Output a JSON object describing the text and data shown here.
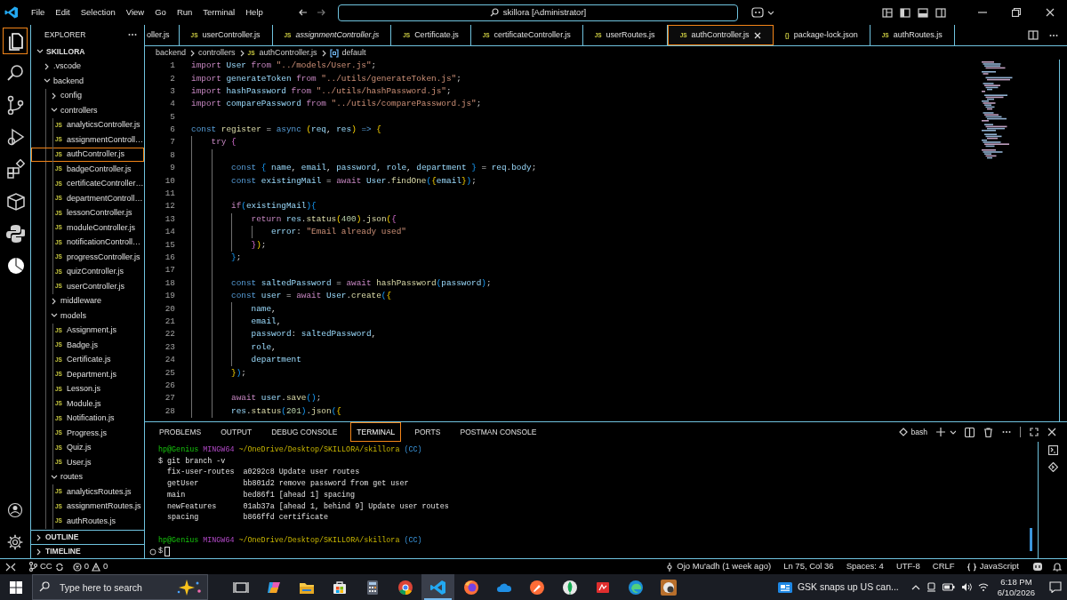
{
  "title_bar": {
    "menu": [
      "File",
      "Edit",
      "Selection",
      "View",
      "Go",
      "Run",
      "Terminal",
      "Help"
    ],
    "command_center": "skillora [Administrator]"
  },
  "activity_bar": {
    "items": [
      {
        "kind": "explorer",
        "selected": true
      },
      {
        "kind": "search",
        "selected": false
      },
      {
        "kind": "source-control",
        "selected": false
      },
      {
        "kind": "run-debug",
        "selected": false
      },
      {
        "kind": "extensions",
        "selected": false
      },
      {
        "kind": "box",
        "selected": false
      },
      {
        "kind": "python",
        "selected": false
      },
      {
        "kind": "chart",
        "selected": false
      }
    ],
    "bottom": [
      {
        "kind": "account"
      },
      {
        "kind": "settings"
      }
    ]
  },
  "sidebar": {
    "title": "EXPLORER",
    "tree": {
      "label": "SKILLORA",
      "kind": "folder",
      "expanded": true,
      "selected": false,
      "children": [
        {
          "label": ".vscode",
          "kind": "folder",
          "expanded": false,
          "selected": false
        },
        {
          "label": "backend",
          "kind": "folder",
          "expanded": true,
          "selected": false,
          "children": [
            {
              "label": "config",
              "kind": "folder",
              "expanded": false,
              "selected": false
            },
            {
              "label": "controllers",
              "kind": "folder",
              "expanded": true,
              "selected": false,
              "children": [
                {
                  "label": "analyticsController.js",
                  "kind": "file",
                  "badge": "JS",
                  "selected": false
                },
                {
                  "label": "assignmentControll…",
                  "kind": "file",
                  "badge": "JS",
                  "selected": false
                },
                {
                  "label": "authController.js",
                  "kind": "file",
                  "badge": "JS",
                  "selected": true
                },
                {
                  "label": "badgeController.js",
                  "kind": "file",
                  "badge": "JS",
                  "selected": false
                },
                {
                  "label": "certificateController…",
                  "kind": "file",
                  "badge": "JS",
                  "selected": false
                },
                {
                  "label": "departmentControll…",
                  "kind": "file",
                  "badge": "JS",
                  "selected": false
                },
                {
                  "label": "lessonController.js",
                  "kind": "file",
                  "badge": "JS",
                  "selected": false
                },
                {
                  "label": "moduleController.js",
                  "kind": "file",
                  "badge": "JS",
                  "selected": false
                },
                {
                  "label": "notificationControll…",
                  "kind": "file",
                  "badge": "JS",
                  "selected": false
                },
                {
                  "label": "progressController.js",
                  "kind": "file",
                  "badge": "JS",
                  "selected": false
                },
                {
                  "label": "quizController.js",
                  "kind": "file",
                  "badge": "JS",
                  "selected": false
                },
                {
                  "label": "userController.js",
                  "kind": "file",
                  "badge": "JS",
                  "selected": false
                }
              ]
            },
            {
              "label": "middleware",
              "kind": "folder",
              "expanded": false,
              "selected": false
            },
            {
              "label": "models",
              "kind": "folder",
              "expanded": true,
              "selected": false,
              "children": [
                {
                  "label": "Assignment.js",
                  "kind": "file",
                  "badge": "JS",
                  "selected": false
                },
                {
                  "label": "Badge.js",
                  "kind": "file",
                  "badge": "JS",
                  "selected": false
                },
                {
                  "label": "Certificate.js",
                  "kind": "file",
                  "badge": "JS",
                  "selected": false
                },
                {
                  "label": "Department.js",
                  "kind": "file",
                  "badge": "JS",
                  "selected": false
                },
                {
                  "label": "Lesson.js",
                  "kind": "file",
                  "badge": "JS",
                  "selected": false
                },
                {
                  "label": "Module.js",
                  "kind": "file",
                  "badge": "JS",
                  "selected": false
                },
                {
                  "label": "Notification.js",
                  "kind": "file",
                  "badge": "JS",
                  "selected": false
                },
                {
                  "label": "Progress.js",
                  "kind": "file",
                  "badge": "JS",
                  "selected": false
                },
                {
                  "label": "Quiz.js",
                  "kind": "file",
                  "badge": "JS",
                  "selected": false
                },
                {
                  "label": "User.js",
                  "kind": "file",
                  "badge": "JS",
                  "selected": false
                }
              ]
            },
            {
              "label": "routes",
              "kind": "folder",
              "expanded": true,
              "selected": false,
              "children": [
                {
                  "label": "analyticsRoutes.js",
                  "kind": "file",
                  "badge": "JS",
                  "selected": false
                },
                {
                  "label": "assignmentRoutes.js",
                  "kind": "file",
                  "badge": "JS",
                  "selected": false
                },
                {
                  "label": "authRoutes.js",
                  "kind": "file",
                  "badge": "JS",
                  "selected": false
                }
              ]
            }
          ]
        }
      ]
    },
    "sections": [
      {
        "label": "OUTLINE",
        "expanded": false
      },
      {
        "label": "TIMELINE",
        "expanded": false
      }
    ]
  },
  "editor": {
    "tabs": [
      {
        "label": "oller.js",
        "selected": false,
        "preview": false
      },
      {
        "label": "userController.js",
        "badge": "JS",
        "selected": false,
        "preview": false
      },
      {
        "label": "assignmentController.js",
        "badge": "JS",
        "selected": false,
        "preview": true
      },
      {
        "label": "Certificate.js",
        "badge": "JS",
        "selected": false,
        "preview": false
      },
      {
        "label": "certificateController.js",
        "badge": "JS",
        "selected": false,
        "preview": false
      },
      {
        "label": "userRoutes.js",
        "badge": "JS",
        "selected": false,
        "preview": false
      },
      {
        "label": "authController.js",
        "badge": "JS",
        "selected": true,
        "preview": false
      },
      {
        "label": "package-lock.json",
        "badge": "{}",
        "selected": false,
        "preview": false
      },
      {
        "label": "authRoutes.js",
        "badge": "JS",
        "selected": false,
        "preview": false
      }
    ],
    "breadcrumb": [
      {
        "label": "backend",
        "kind": "folder"
      },
      {
        "label": "controllers",
        "kind": "folder"
      },
      {
        "label": "authController.js",
        "kind": "file",
        "badge": "JS"
      },
      {
        "label": "default",
        "kind": "symbol"
      }
    ],
    "lines": [
      {
        "number": "1",
        "tokens": [
          {
            "kind": "kw",
            "text": "import "
          },
          {
            "kind": "var",
            "text": "User "
          },
          {
            "kind": "kw",
            "text": "from "
          },
          {
            "kind": "str",
            "text": "\"../models/User.js\""
          },
          {
            "kind": "p",
            "text": ";"
          }
        ]
      },
      {
        "number": "2",
        "tokens": [
          {
            "kind": "kw",
            "text": "import "
          },
          {
            "kind": "var",
            "text": "generateToken "
          },
          {
            "kind": "kw",
            "text": "from "
          },
          {
            "kind": "str",
            "text": "\"../utils/generateToken.js\""
          },
          {
            "kind": "p",
            "text": ";"
          }
        ]
      },
      {
        "number": "3",
        "tokens": [
          {
            "kind": "kw",
            "text": "import "
          },
          {
            "kind": "var",
            "text": "hashPassword "
          },
          {
            "kind": "kw",
            "text": "from "
          },
          {
            "kind": "str",
            "text": "\"../utils/hashPassword.js\""
          },
          {
            "kind": "p",
            "text": ";"
          }
        ]
      },
      {
        "number": "4",
        "tokens": [
          {
            "kind": "kw",
            "text": "import "
          },
          {
            "kind": "var",
            "text": "comparePassword "
          },
          {
            "kind": "kw",
            "text": "from "
          },
          {
            "kind": "str",
            "text": "\"../utils/comparePassword.js\""
          },
          {
            "kind": "p",
            "text": ";"
          }
        ]
      },
      {
        "number": "5"
      },
      {
        "number": "6",
        "tokens": [
          {
            "kind": "st",
            "text": "const "
          },
          {
            "kind": "fn",
            "text": "register"
          },
          {
            "kind": "p",
            "text": " = "
          },
          {
            "kind": "st",
            "text": "async "
          },
          {
            "kind": "b1",
            "text": "("
          },
          {
            "kind": "var",
            "text": "req"
          },
          {
            "kind": "p",
            "text": ", "
          },
          {
            "kind": "var",
            "text": "res"
          },
          {
            "kind": "b1",
            "text": ")"
          },
          {
            "kind": "st",
            "text": " => "
          },
          {
            "kind": "b1",
            "text": "{"
          }
        ]
      },
      {
        "number": "7",
        "tokens": [
          {
            "kind": "kw",
            "text": "    try "
          },
          {
            "kind": "b2",
            "text": "{"
          }
        ]
      },
      {
        "number": "8"
      },
      {
        "number": "9",
        "tokens": [
          {
            "kind": "st",
            "text": "        const "
          },
          {
            "kind": "b3",
            "text": "{ "
          },
          {
            "kind": "var",
            "text": "name"
          },
          {
            "kind": "p",
            "text": ", "
          },
          {
            "kind": "var",
            "text": "email"
          },
          {
            "kind": "p",
            "text": ", "
          },
          {
            "kind": "var",
            "text": "password"
          },
          {
            "kind": "p",
            "text": ", "
          },
          {
            "kind": "var",
            "text": "role"
          },
          {
            "kind": "p",
            "text": ", "
          },
          {
            "kind": "var",
            "text": "department"
          },
          {
            "kind": "b3",
            "text": " }"
          },
          {
            "kind": "p",
            "text": " = "
          },
          {
            "kind": "var",
            "text": "req"
          },
          {
            "kind": "p",
            "text": "."
          },
          {
            "kind": "var",
            "text": "body"
          },
          {
            "kind": "p",
            "text": ";"
          }
        ]
      },
      {
        "number": "10",
        "tokens": [
          {
            "kind": "st",
            "text": "        const "
          },
          {
            "kind": "var",
            "text": "existingMail"
          },
          {
            "kind": "p",
            "text": " = "
          },
          {
            "kind": "kw",
            "text": "await "
          },
          {
            "kind": "var",
            "text": "User"
          },
          {
            "kind": "p",
            "text": "."
          },
          {
            "kind": "fn",
            "text": "findOne"
          },
          {
            "kind": "b3",
            "text": "("
          },
          {
            "kind": "b1",
            "text": "{"
          },
          {
            "kind": "var",
            "text": "email"
          },
          {
            "kind": "b1",
            "text": "}"
          },
          {
            "kind": "b3",
            "text": ")"
          },
          {
            "kind": "p",
            "text": ";"
          }
        ]
      },
      {
        "number": "11"
      },
      {
        "number": "12",
        "tokens": [
          {
            "kind": "kw",
            "text": "        if"
          },
          {
            "kind": "b3",
            "text": "("
          },
          {
            "kind": "var",
            "text": "existingMail"
          },
          {
            "kind": "b3",
            "text": "){"
          }
        ]
      },
      {
        "number": "13",
        "tokens": [
          {
            "kind": "kw",
            "text": "            return "
          },
          {
            "kind": "var",
            "text": "res"
          },
          {
            "kind": "p",
            "text": "."
          },
          {
            "kind": "fn",
            "text": "status"
          },
          {
            "kind": "b1",
            "text": "("
          },
          {
            "kind": "num",
            "text": "400"
          },
          {
            "kind": "b1",
            "text": ")"
          },
          {
            "kind": "p",
            "text": "."
          },
          {
            "kind": "fn",
            "text": "json"
          },
          {
            "kind": "b1",
            "text": "("
          },
          {
            "kind": "b2",
            "text": "{"
          }
        ]
      },
      {
        "number": "14",
        "tokens": [
          {
            "kind": "var",
            "text": "                error"
          },
          {
            "kind": "p",
            "text": ": "
          },
          {
            "kind": "str",
            "text": "\"Email already used\""
          }
        ]
      },
      {
        "number": "15",
        "tokens": [
          {
            "kind": "b2",
            "text": "            }"
          },
          {
            "kind": "b1",
            "text": ")"
          },
          {
            "kind": "p",
            "text": ";"
          }
        ]
      },
      {
        "number": "16",
        "tokens": [
          {
            "kind": "b3",
            "text": "        }"
          },
          {
            "kind": "p",
            "text": ";"
          }
        ]
      },
      {
        "number": "17"
      },
      {
        "number": "18",
        "tokens": [
          {
            "kind": "st",
            "text": "        const "
          },
          {
            "kind": "var",
            "text": "saltedPassword"
          },
          {
            "kind": "p",
            "text": " = "
          },
          {
            "kind": "kw",
            "text": "await "
          },
          {
            "kind": "fn",
            "text": "hashPassword"
          },
          {
            "kind": "b3",
            "text": "("
          },
          {
            "kind": "var",
            "text": "password"
          },
          {
            "kind": "b3",
            "text": ")"
          },
          {
            "kind": "p",
            "text": ";"
          }
        ]
      },
      {
        "number": "19",
        "tokens": [
          {
            "kind": "st",
            "text": "        const "
          },
          {
            "kind": "var",
            "text": "user"
          },
          {
            "kind": "p",
            "text": " = "
          },
          {
            "kind": "kw",
            "text": "await "
          },
          {
            "kind": "var",
            "text": "User"
          },
          {
            "kind": "p",
            "text": "."
          },
          {
            "kind": "fn",
            "text": "create"
          },
          {
            "kind": "b3",
            "text": "("
          },
          {
            "kind": "b1",
            "text": "{"
          }
        ]
      },
      {
        "number": "20",
        "tokens": [
          {
            "kind": "var",
            "text": "            name"
          },
          {
            "kind": "p",
            "text": ","
          }
        ]
      },
      {
        "number": "21",
        "tokens": [
          {
            "kind": "var",
            "text": "            email"
          },
          {
            "kind": "p",
            "text": ","
          }
        ]
      },
      {
        "number": "22",
        "tokens": [
          {
            "kind": "var",
            "text": "            password"
          },
          {
            "kind": "p",
            "text": ": "
          },
          {
            "kind": "var",
            "text": "saltedPassword"
          },
          {
            "kind": "p",
            "text": ","
          }
        ]
      },
      {
        "number": "23",
        "tokens": [
          {
            "kind": "var",
            "text": "            role"
          },
          {
            "kind": "p",
            "text": ","
          }
        ]
      },
      {
        "number": "24",
        "tokens": [
          {
            "kind": "var",
            "text": "            department"
          }
        ]
      },
      {
        "number": "25",
        "tokens": [
          {
            "kind": "b1",
            "text": "        }"
          },
          {
            "kind": "b3",
            "text": ")"
          },
          {
            "kind": "p",
            "text": ";"
          }
        ]
      },
      {
        "number": "26"
      },
      {
        "number": "27",
        "tokens": [
          {
            "kind": "kw",
            "text": "        await "
          },
          {
            "kind": "var",
            "text": "user"
          },
          {
            "kind": "p",
            "text": "."
          },
          {
            "kind": "fn",
            "text": "save"
          },
          {
            "kind": "b3",
            "text": "()"
          },
          {
            "kind": "p",
            "text": ";"
          }
        ]
      },
      {
        "number": "28",
        "tokens": [
          {
            "kind": "var",
            "text": "        res"
          },
          {
            "kind": "p",
            "text": "."
          },
          {
            "kind": "fn",
            "text": "status"
          },
          {
            "kind": "b3",
            "text": "("
          },
          {
            "kind": "num",
            "text": "201"
          },
          {
            "kind": "b3",
            "text": ")"
          },
          {
            "kind": "p",
            "text": "."
          },
          {
            "kind": "fn",
            "text": "json"
          },
          {
            "kind": "b3",
            "text": "("
          },
          {
            "kind": "b1",
            "text": "{"
          }
        ]
      }
    ]
  },
  "panel": {
    "tabs": [
      {
        "label": "PROBLEMS",
        "selected": false
      },
      {
        "label": "OUTPUT",
        "selected": false
      },
      {
        "label": "DEBUG CONSOLE",
        "selected": false
      },
      {
        "label": "TERMINAL",
        "selected": true
      },
      {
        "label": "PORTS",
        "selected": false
      },
      {
        "label": "POSTMAN CONSOLE",
        "selected": false
      }
    ],
    "shell": "bash",
    "terminal": [
      {
        "kind": "prompt",
        "user": "hp@Genius",
        "host": "MINGW64",
        "path": "~/OneDrive/Desktop/SKILLORA/skillora",
        "branch": "(CC)"
      },
      {
        "kind": "text",
        "text": "$ git branch -v"
      },
      {
        "kind": "text",
        "text": "  fix-user-routes  a0292c8 Update user routes"
      },
      {
        "kind": "text",
        "text": "  getUser          bb801d2 remove password from get user"
      },
      {
        "kind": "text",
        "text": "  main             bed86f1 [ahead 1] spacing"
      },
      {
        "kind": "text",
        "text": "  newFeatures      01ab37a [ahead 1, behind 9] Update user routes"
      },
      {
        "kind": "text",
        "text": "  spacing          b866ffd certificate"
      },
      {
        "kind": "blank"
      },
      {
        "kind": "prompt",
        "user": "hp@Genius",
        "host": "MINGW64",
        "path": "~/OneDrive/Desktop/SKILLORA/skillora",
        "branch": "(CC)"
      },
      {
        "kind": "input",
        "text": "$"
      }
    ]
  },
  "status_bar": {
    "branch": "CC",
    "errors": "0",
    "warnings": "0",
    "blame": "Ojo Mu'adh (1 week ago)",
    "position": "Ln 75, Col 36",
    "indentation": "Spaces: 4",
    "encoding": "UTF-8",
    "line_endings": "CRLF",
    "language": "JavaScript"
  },
  "taskbar": {
    "search_placeholder": "Type here to search",
    "apps": [
      {
        "kind": "task-view",
        "active": false
      },
      {
        "kind": "copilot",
        "active": false
      },
      {
        "kind": "files",
        "active": false
      },
      {
        "kind": "store",
        "active": false
      },
      {
        "kind": "calculator",
        "active": false
      },
      {
        "kind": "chrome",
        "active": false
      },
      {
        "kind": "vscode",
        "active": true
      },
      {
        "kind": "firefox",
        "active": false
      },
      {
        "kind": "onedrive",
        "active": false
      },
      {
        "kind": "postman",
        "active": false
      },
      {
        "kind": "mongodb",
        "active": false
      },
      {
        "kind": "pdf",
        "active": false
      },
      {
        "kind": "edge",
        "active": false
      },
      {
        "kind": "camera-app",
        "active": false
      }
    ],
    "news": "GSK snaps up US can...",
    "time": "6:18 PM",
    "date": "6/10/2026"
  }
}
